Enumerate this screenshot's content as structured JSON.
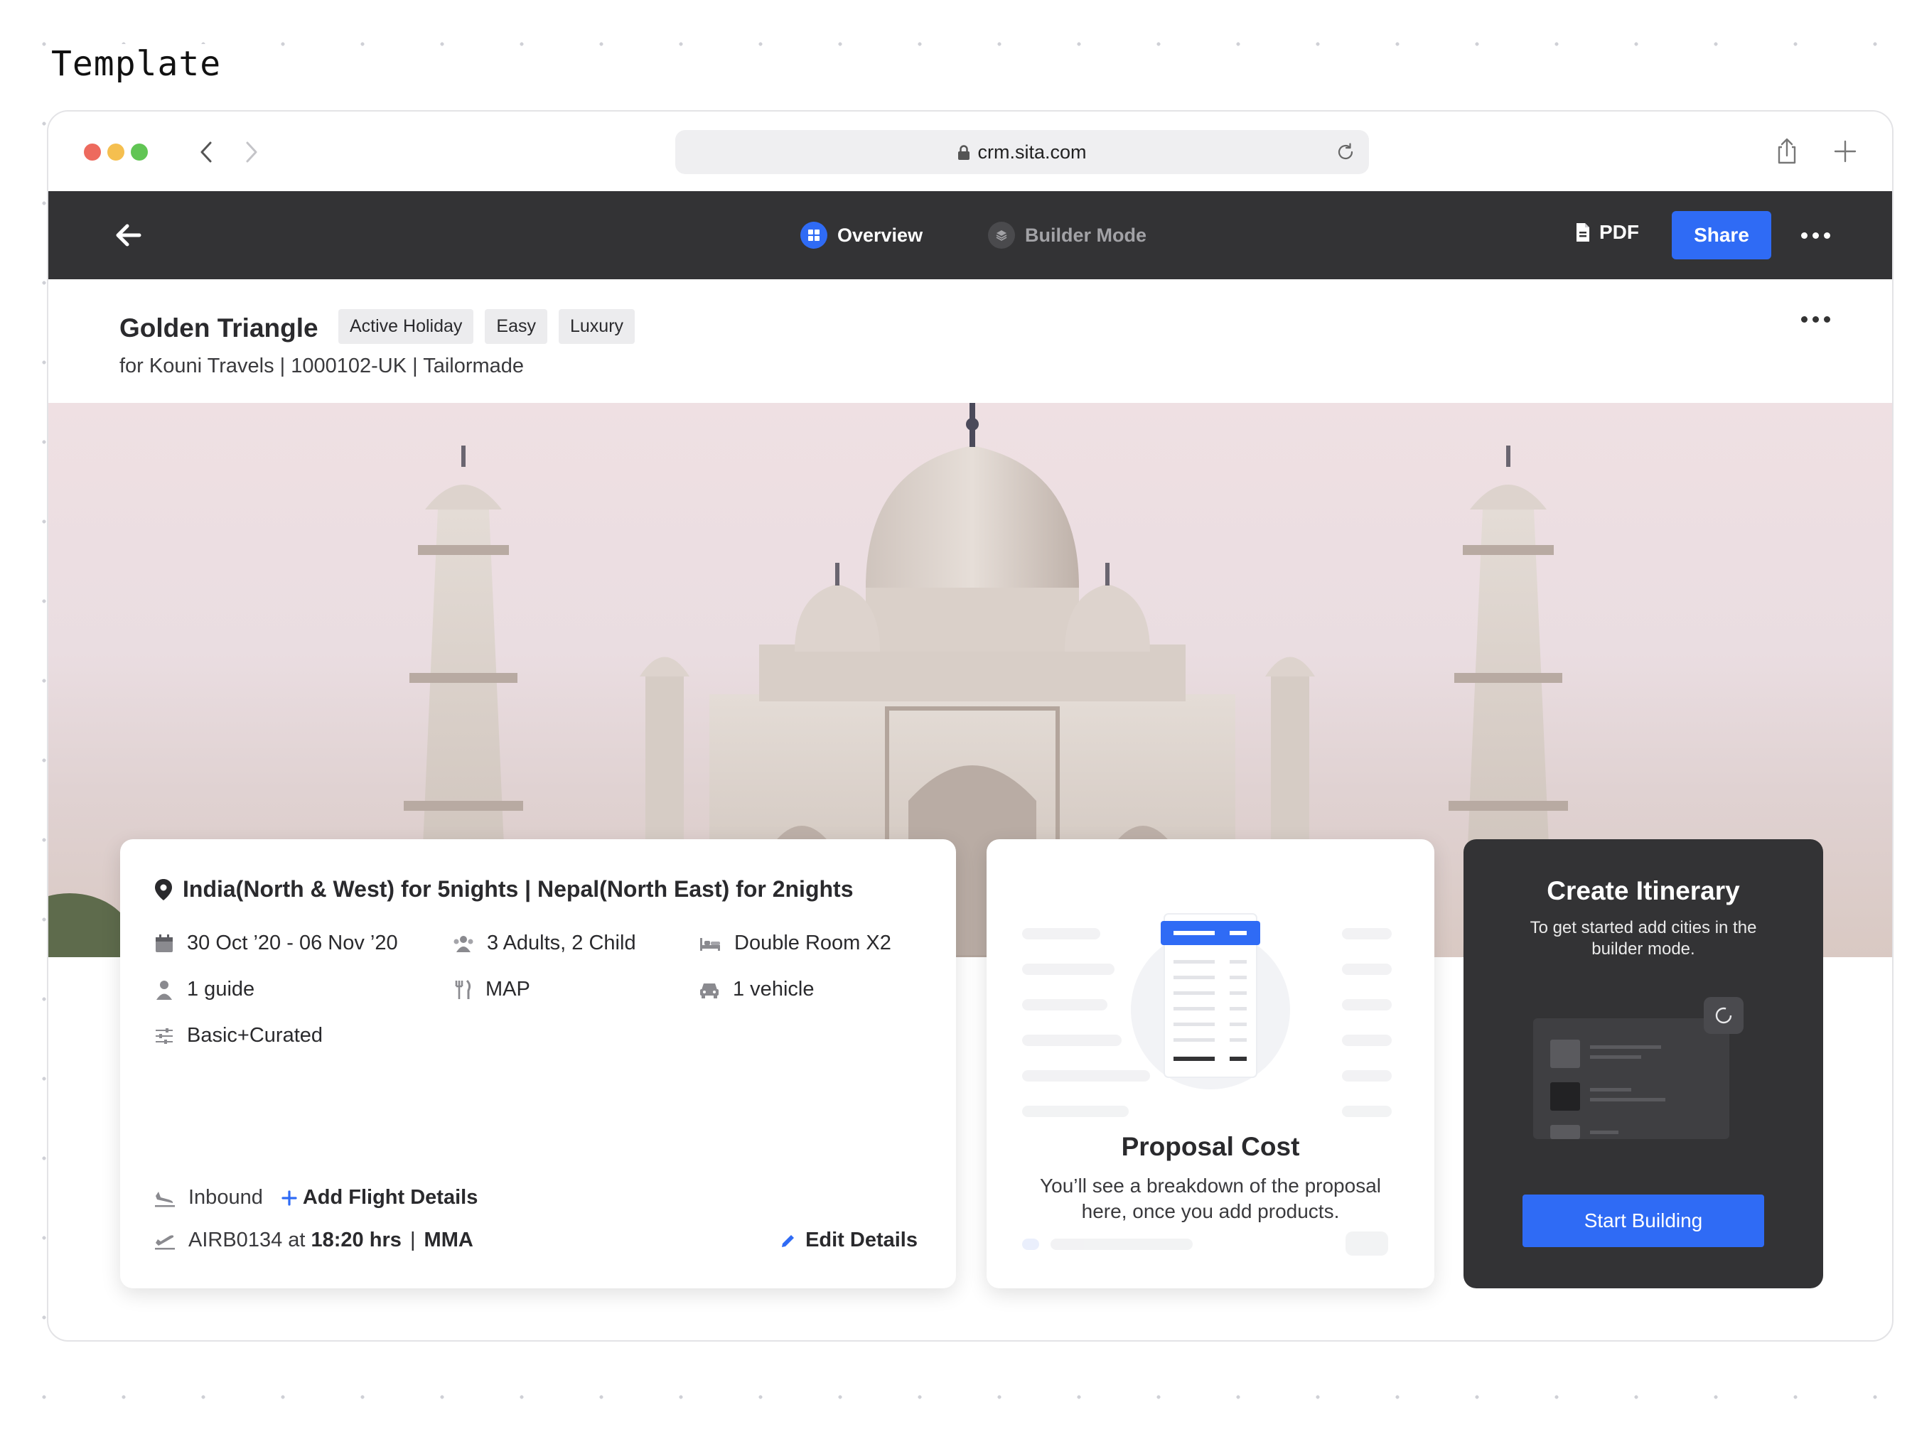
{
  "page_label": "Template",
  "browser": {
    "url": "crm.sita.com",
    "traffic_lights": [
      "#ed6a5e",
      "#f5bf4f",
      "#61c554"
    ]
  },
  "header": {
    "tabs": [
      {
        "label": "Overview",
        "active": true
      },
      {
        "label": "Builder Mode",
        "active": false
      }
    ],
    "pdf_label": "PDF",
    "share_label": "Share",
    "accent": "#2f6bf5"
  },
  "trip": {
    "title": "Golden Triangle",
    "tags": [
      "Active Holiday",
      "Easy",
      "Luxury"
    ],
    "subtitle": "for Kouni Travels | 1000102-UK | Tailormade"
  },
  "details": {
    "destination": "India(North & West) for 5nights | Nepal(North East) for 2nights",
    "dates": "30 Oct ’20 - 06 Nov ’20",
    "pax": "3 Adults, 2 Child",
    "room": "Double Room X2",
    "guide": "1 guide",
    "meal": "MAP",
    "vehicle": "1 vehicle",
    "category": "Basic+Curated",
    "inbound_label": "Inbound",
    "add_flight_label": "Add Flight Details",
    "outbound_flight": "AIRB0134 at",
    "outbound_time": "18:20 hrs",
    "outbound_airport": "MMA",
    "edit_label": "Edit Details"
  },
  "cost": {
    "title": "Proposal Cost",
    "description": "You’ll see a breakdown of the proposal here, once you add products."
  },
  "create": {
    "title": "Create Itinerary",
    "description": "To get started add cities in the builder mode.",
    "button_label": "Start Building"
  }
}
